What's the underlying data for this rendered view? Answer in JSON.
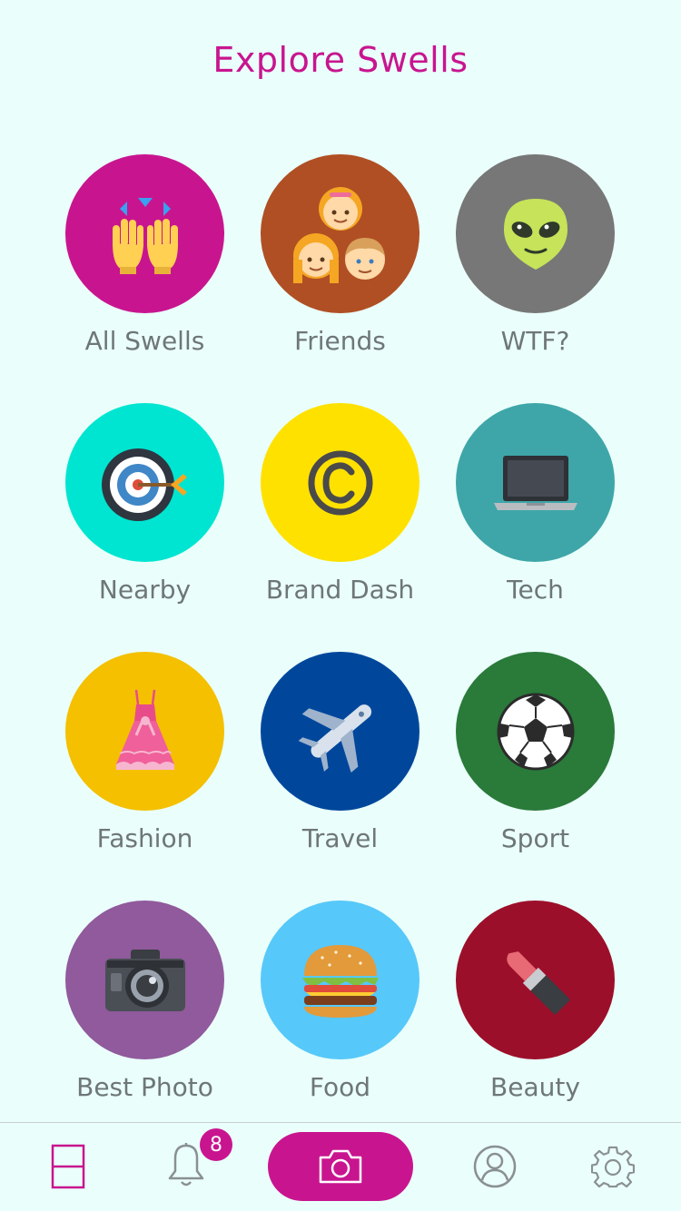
{
  "header": {
    "title": "Explore Swells"
  },
  "categories": [
    {
      "label": "All Swells",
      "color": "#c8158f",
      "icon": "raised-hands-icon"
    },
    {
      "label": "Friends",
      "color": "#b04f24",
      "icon": "family-faces-icon"
    },
    {
      "label": "WTF?",
      "color": "#777777",
      "icon": "alien-icon"
    },
    {
      "label": "Nearby",
      "color": "#00e5d1",
      "icon": "target-icon"
    },
    {
      "label": "Brand Dash",
      "color": "#ffe100",
      "icon": "copyright-icon"
    },
    {
      "label": "Tech",
      "color": "#3ea6a8",
      "icon": "laptop-icon"
    },
    {
      "label": "Fashion",
      "color": "#f4c000",
      "icon": "dress-icon"
    },
    {
      "label": "Travel",
      "color": "#00479c",
      "icon": "airplane-icon"
    },
    {
      "label": "Sport",
      "color": "#2a7a3a",
      "icon": "soccer-ball-icon"
    },
    {
      "label": "Best Photo",
      "color": "#905a9c",
      "icon": "camera-icon"
    },
    {
      "label": "Food",
      "color": "#56c8fa",
      "icon": "burger-icon"
    },
    {
      "label": "Beauty",
      "color": "#9c0f2a",
      "icon": "lipstick-icon"
    }
  ],
  "tabbar": {
    "notifications_count": "8",
    "accent_color": "#c8158f",
    "items": [
      "grid-icon",
      "bell-icon",
      "camera-icon",
      "profile-icon",
      "gear-icon"
    ]
  }
}
